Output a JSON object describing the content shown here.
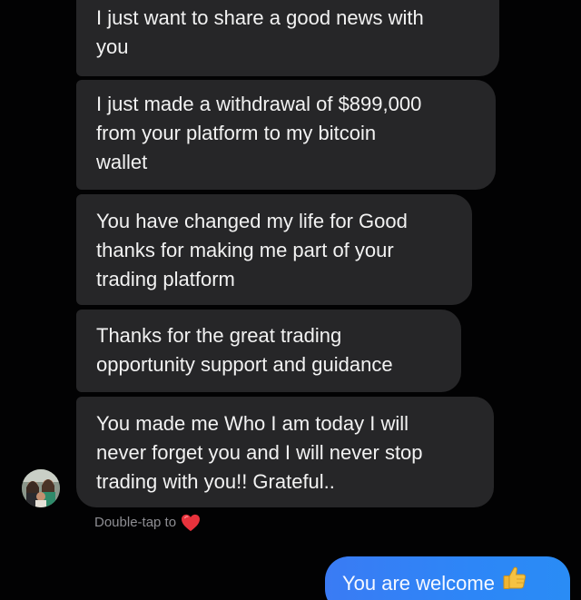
{
  "messages": [
    {
      "text": "I just want to share  a good news with\nyou"
    },
    {
      "text": "I just made a withdrawal of $899,000\nfrom your platform to my bitcoin\nwallet"
    },
    {
      "text": "You have changed my life for Good\nthanks for making me part of your\ntrading platform"
    },
    {
      "text": "Thanks for the great trading\nopportunity support and guidance"
    },
    {
      "text": "You made me Who I am today I will\nnever forget you and I will never stop\ntrading with you!! Grateful.."
    }
  ],
  "reaction_hint": {
    "text": "Double-tap to",
    "icon": "heart-icon",
    "icon_color": "#e8323c"
  },
  "reply": {
    "text": "You are welcome",
    "icon": "thumbs-up-icon",
    "icon_color": "#f5c242"
  },
  "colors": {
    "background": "#020203",
    "received_bubble": "#262628",
    "sent_bubble": "#3a7bf4"
  }
}
